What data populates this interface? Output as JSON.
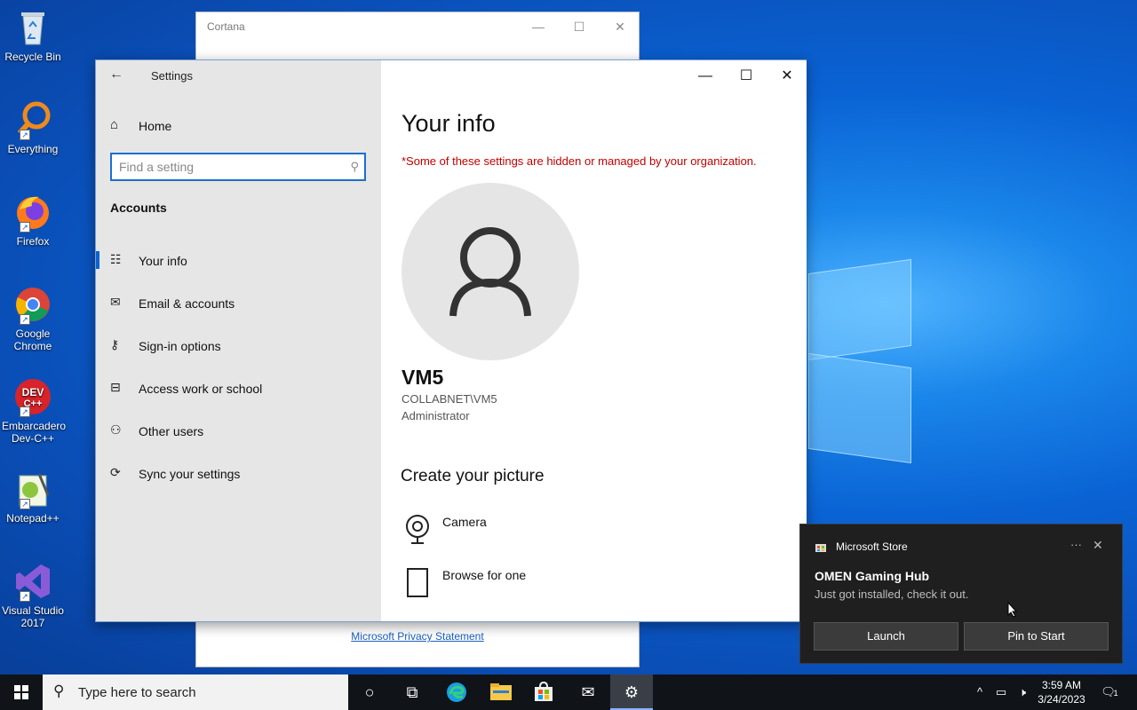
{
  "desktop": {
    "icons": [
      {
        "label": "Recycle Bin",
        "icon": "recycle-bin-icon"
      },
      {
        "label": "Everything",
        "icon": "everything-search-icon"
      },
      {
        "label": "Firefox",
        "icon": "firefox-icon"
      },
      {
        "label": "Google Chrome",
        "icon": "chrome-icon"
      },
      {
        "label": "Embarcadero Dev-C++",
        "icon": "devcpp-icon"
      },
      {
        "label": "Notepad++",
        "icon": "notepadpp-icon"
      },
      {
        "label": "Visual Studio 2017",
        "icon": "visual-studio-icon"
      }
    ]
  },
  "cortana": {
    "title": "Cortana",
    "privacy_link": "Microsoft Privacy Statement"
  },
  "settings": {
    "title": "Settings",
    "home_label": "Home",
    "search_placeholder": "Find a setting",
    "section_title": "Accounts",
    "nav_items": [
      {
        "label": "Your info",
        "icon": "contact-card-icon",
        "active": true
      },
      {
        "label": "Email & accounts",
        "icon": "mail-icon",
        "active": false
      },
      {
        "label": "Sign-in options",
        "icon": "key-icon",
        "active": false
      },
      {
        "label": "Access work or school",
        "icon": "briefcase-icon",
        "active": false
      },
      {
        "label": "Other users",
        "icon": "person-add-icon",
        "active": false
      },
      {
        "label": "Sync your settings",
        "icon": "sync-icon",
        "active": false
      }
    ],
    "content": {
      "page_title": "Your info",
      "warning": "*Some of these settings are hidden or managed by your organization.",
      "user_name": "VM5",
      "user_domain": "COLLABNET\\VM5",
      "user_role": "Administrator",
      "create_picture_title": "Create your picture",
      "options": [
        {
          "label": "Camera",
          "icon": "camera-icon"
        },
        {
          "label": "Browse for one",
          "icon": "file-icon"
        }
      ]
    }
  },
  "toast": {
    "app_name": "Microsoft Store",
    "headline": "OMEN Gaming Hub",
    "body": "Just got installed, check it out.",
    "buttons": [
      "Launch",
      "Pin to Start"
    ]
  },
  "taskbar": {
    "search_placeholder": "Type here to search",
    "time": "3:59 AM",
    "date": "3/24/2023",
    "notification_count": "1"
  },
  "colors": {
    "accent": "#0a64d0",
    "warning": "#c00000",
    "toast_bg": "#1f1f1f",
    "taskbar_bg": "#101419"
  }
}
